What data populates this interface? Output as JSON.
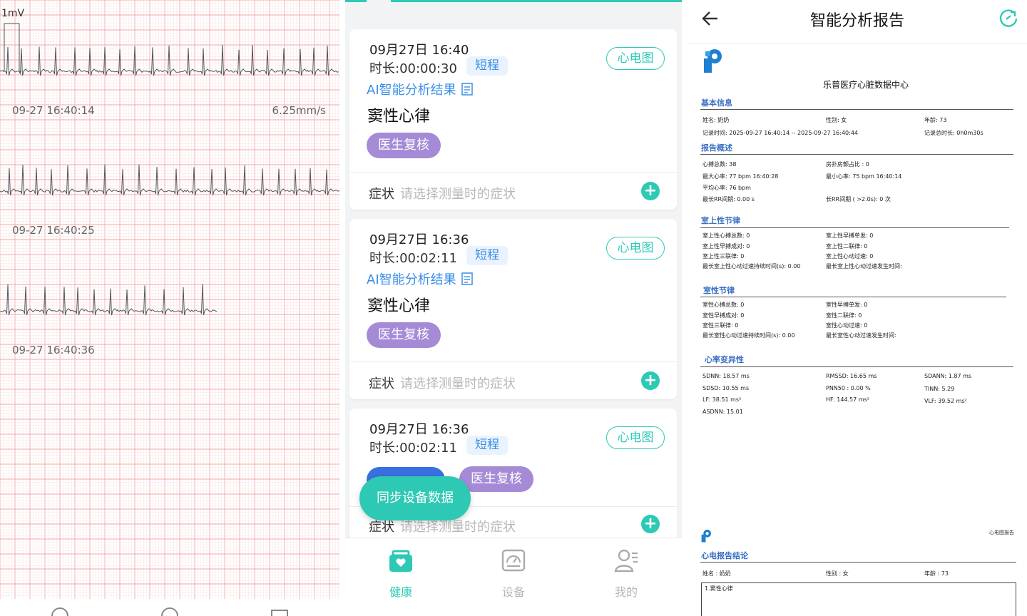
{
  "ecg": {
    "scale_label": "1mV",
    "speed": "6.25mm/s",
    "timestamps": [
      "09-27 16:40:14",
      "09-27 16:40:25",
      "09-27 16:40:36"
    ]
  },
  "list": {
    "cards": [
      {
        "datetime": "09月27日 16:40",
        "duration": "时长:00:00:30",
        "tag": "短程",
        "ecg_button": "心电图",
        "ai_link": "AI智能分析结果",
        "rhythm": "窦性心律",
        "review_button": "医生复核",
        "symptom_label": "症状",
        "symptom_placeholder": "请选择测量时的症状"
      },
      {
        "datetime": "09月27日 16:36",
        "duration": "时长:00:02:11",
        "tag": "短程",
        "ecg_button": "心电图",
        "ai_link": "AI智能分析结果",
        "rhythm": "窦性心律",
        "review_button": "医生复核",
        "symptom_label": "症状",
        "symptom_placeholder": "请选择测量时的症状"
      },
      {
        "datetime": "09月27日 16:36",
        "duration": "时长:00:02:11",
        "tag": "短程",
        "ecg_button": "心电图",
        "review_button": "医生复核",
        "symptom_label": "症状",
        "symptom_placeholder": "请选择测量时的症状"
      }
    ],
    "sync_button": "同步设备数据",
    "tabs": [
      {
        "label": "健康",
        "icon": "medical-bag-icon",
        "active": true
      },
      {
        "label": "设备",
        "icon": "device-monitor-icon",
        "active": false
      },
      {
        "label": "我的",
        "icon": "user-profile-icon",
        "active": false
      }
    ],
    "colors": {
      "accent": "#2ec9b5",
      "review": "#a58bd6",
      "link": "#3a8ee6"
    }
  },
  "report": {
    "title": "智能分析报告",
    "org": "乐普医疗心脏数据中心",
    "sections": {
      "basic": "基本信息",
      "overview": "报告概述",
      "supra": "室上性节律",
      "vent": "室性节律",
      "hrv": "心率变异性",
      "conclusion": "心电报告结论"
    },
    "basic": {
      "name": "姓名:   奶奶",
      "gender": "性别:  女",
      "age": "年龄:     73",
      "record_time": "记录时间:   2025-09-27 16:40:14     --     2025-09-27 16:40:44",
      "record_total": "记录总时长:     0h0m30s"
    },
    "overview": {
      "beats": "心搏总数:        38",
      "af_ratio": "房扑房颤占比 : 0",
      "max_hr": "最大心率:      77       bpm     16:40:28",
      "min_hr": "最小心率:  75       bpm    16:40:14",
      "avg_hr": "平均心率:      76        bpm",
      "longest_rr": "最长RR间期:       0.00          s",
      "long_rr": "长RR间期 ( >2.0s):      0               次"
    },
    "supra": {
      "total": "室上性心搏总数:      0",
      "single": "室上性早搏单发:        0",
      "pair": "室上性早搏成对:        0",
      "bigeminy": "室上性二联律:            0",
      "trigeminy": "室上性三联律:      0",
      "tachy": "室上性心动过速:         0",
      "longest": "最长室上性心动过速持续时间(s):        0.00",
      "longest_time": "最长室上性心动过速发生时间:"
    },
    "vent": {
      "total": "室性心搏总数:   0",
      "single": "室性早搏单发:      0",
      "pair": "室性早搏成对:     0",
      "bigeminy": "室性二联律:          0",
      "trigeminy": "室性三联律:     0",
      "tachy": "室性心动过速:      0",
      "longest": "最长室性心动过速持续时间(s):        0.00",
      "longest_time": "最长室性心动过速发生时间:"
    },
    "hrv": {
      "sdnn": "SDNN:    18.57          ms",
      "rmssd": "RMSSD:    16.65          ms",
      "sdann": "SDANN:   1.87             ms",
      "sdsd": "SDSD:      10.55           ms",
      "pnn50": "PNN50 :     0.00           %",
      "tinn": "TINN:     5.29",
      "lf": "LF:     38.51           ms²",
      "hf": "HF:    144.57         ms²",
      "vlf": "VLF:    39.52           ms²",
      "asdnn": "ASDNN:      15.01"
    },
    "page2": {
      "tag": "心电图报告",
      "name": "姓名 : 奶奶",
      "gender": "性别 : 女",
      "age": "年龄 : 73",
      "conclusion": "1.窦性心律"
    }
  }
}
